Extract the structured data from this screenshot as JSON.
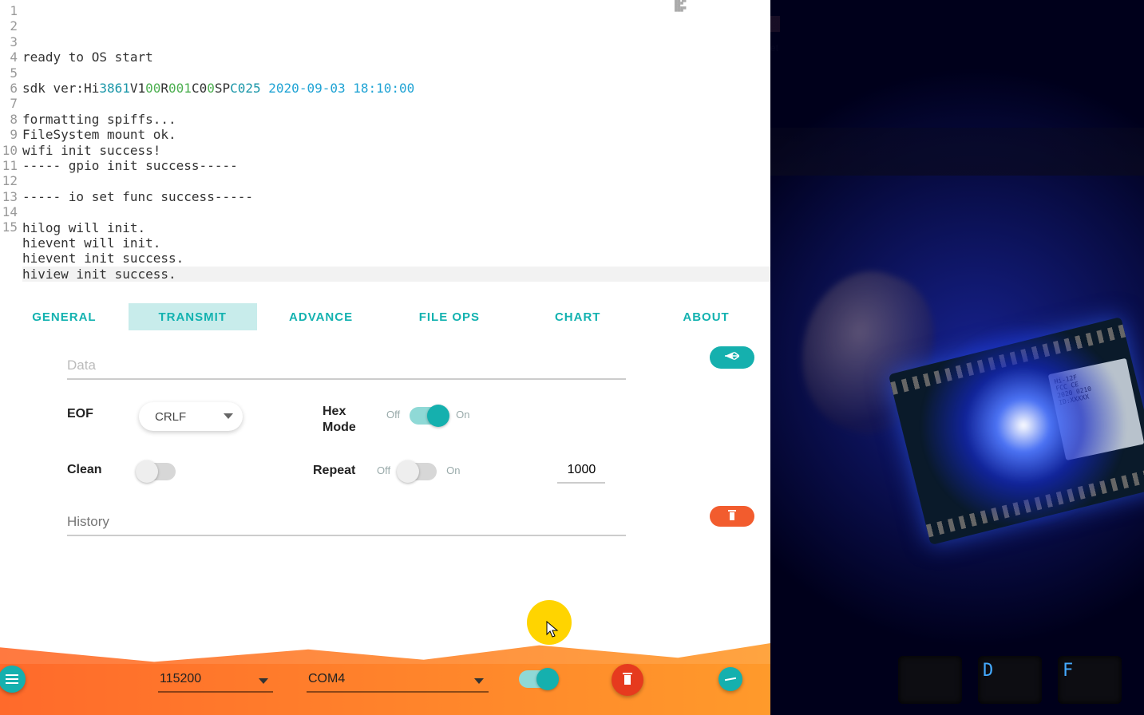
{
  "console": {
    "lines": [
      {
        "n": 1,
        "plain": "ready to OS start"
      },
      {
        "n": 2,
        "plain": ""
      },
      {
        "n": 3,
        "sdk": true,
        "prefix": "sdk ver:Hi",
        "p1": "3861",
        "p2": "V1",
        "p3": "00",
        "p4": "R",
        "p5": "001",
        "p6": "C0",
        "p7": "0",
        "p8": "SP",
        "p9": "C025",
        "sp": " ",
        "date": "2020-09-03 18:10:00"
      },
      {
        "n": 4,
        "plain": ""
      },
      {
        "n": 5,
        "plain": "formatting spiffs..."
      },
      {
        "n": 6,
        "plain": "FileSystem mount ok."
      },
      {
        "n": 7,
        "plain": "wifi init success!"
      },
      {
        "n": 8,
        "plain": "----- gpio init success-----"
      },
      {
        "n": 9,
        "plain": ""
      },
      {
        "n": 10,
        "plain": "----- io set func success-----"
      },
      {
        "n": 11,
        "plain": ""
      },
      {
        "n": 12,
        "plain": "hilog will init."
      },
      {
        "n": 13,
        "plain": "hievent will init."
      },
      {
        "n": 14,
        "plain": "hievent init success."
      },
      {
        "n": 15,
        "plain": "hiview init success.",
        "hi": true
      }
    ]
  },
  "tabs": {
    "items": [
      {
        "label": "GENERAL"
      },
      {
        "label": "TRANSMIT"
      },
      {
        "label": "ADVANCE"
      },
      {
        "label": "FILE OPS"
      },
      {
        "label": "CHART"
      },
      {
        "label": "ABOUT"
      }
    ],
    "active_index": 1
  },
  "transmit": {
    "data_placeholder": "Data",
    "send_icon": "send-icon",
    "eof_label": "EOF",
    "eof_value": "CRLF",
    "hex_label_line1": "Hex",
    "hex_label_line2": "Mode",
    "off_label": "Off",
    "on_label": "On",
    "hex_on": true,
    "clean_label": "Clean",
    "clean_on": false,
    "repeat_label": "Repeat",
    "repeat_on": false,
    "repeat_interval": "1000",
    "history_placeholder": "History",
    "delete_icon": "trash-icon"
  },
  "bottom": {
    "menu_icon": "menu-icon",
    "baud_value": "115200",
    "port_value": "COM4",
    "connect_on": true,
    "clear_icon": "trash-icon",
    "extra_icon": "wave-icon"
  },
  "hardware": {
    "chip_label": "Hi-12F",
    "keys": [
      "",
      "D",
      "F"
    ]
  }
}
